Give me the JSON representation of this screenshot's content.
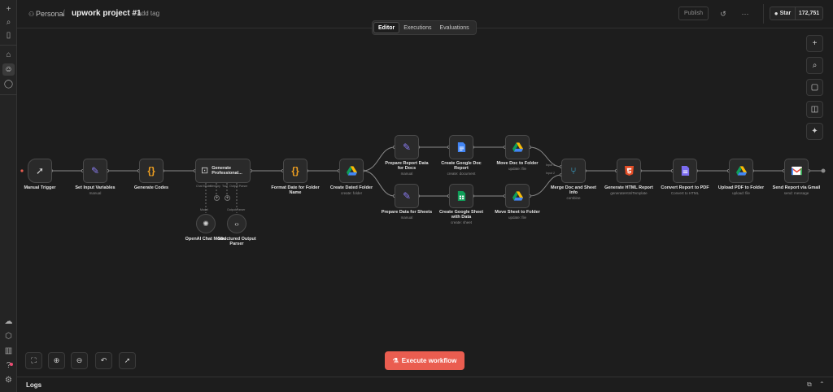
{
  "header": {
    "breadcrumb_project": "Personal",
    "separator": "/",
    "workflow_title": "upwork project #1",
    "add_tag": "+ Add tag",
    "publish": "Publish",
    "github_star": "Star",
    "github_count": "172,751"
  },
  "tabs": [
    "Editor",
    "Executions",
    "Evaluations"
  ],
  "active_tab": "Editor",
  "nodes": {
    "manual_trigger": {
      "label": "Manual Trigger",
      "icon": "cursor-icon"
    },
    "set_input": {
      "label": "Set Input Variables",
      "sub": "manual",
      "icon": "pencil-icon"
    },
    "generate_codes": {
      "label": "Generate Codes",
      "icon": "code-braces-icon"
    },
    "generate_prof": {
      "label": "Generate Professional...",
      "icon": "robot-icon",
      "port_chat": "Chat Model",
      "port_memory": "Memory",
      "port_tool": "Tool",
      "port_output": "Output Parser"
    },
    "openai_chat": {
      "label": "OpenAI Chat Model",
      "icon": "openai-icon"
    },
    "structured_parser": {
      "label": "Structured Output Parser",
      "icon": "code-tag-icon"
    },
    "format_date": {
      "label": "Format Date for Folder Name",
      "icon": "code-braces-icon"
    },
    "create_folder": {
      "label": "Create Dated Folder",
      "sub": "create: folder",
      "icon": "google-drive-icon"
    },
    "prepare_docs": {
      "label": "Prepare Report Data for Docs",
      "sub": "manual",
      "icon": "pencil-icon"
    },
    "create_doc": {
      "label": "Create Google Doc Report",
      "sub": "create: document",
      "icon": "google-docs-icon"
    },
    "move_doc": {
      "label": "Move Doc to Folder",
      "sub": "update: file",
      "icon": "google-drive-icon"
    },
    "prepare_sheets": {
      "label": "Prepare Data for Sheets",
      "sub": "manual",
      "icon": "pencil-icon"
    },
    "create_sheet": {
      "label": "Create Google Sheet with Data",
      "sub": "create: sheet",
      "icon": "google-sheets-icon"
    },
    "move_sheet": {
      "label": "Move Sheet to Folder",
      "sub": "update: file",
      "icon": "google-drive-icon"
    },
    "merge": {
      "label": "Merge Doc and Sheet Info",
      "sub": "combine",
      "icon": "merge-icon",
      "input1": "Input 1",
      "input2": "Input 2"
    },
    "gen_html": {
      "label": "Generate HTML Report",
      "sub": "generateHtmlTemplate",
      "icon": "html5-icon"
    },
    "convert_pdf": {
      "label": "Convert Report to PDF",
      "sub": "Convert to HTML",
      "icon": "pdf-convert-icon"
    },
    "upload_pdf": {
      "label": "Upload PDF to Folder",
      "sub": "upload: file",
      "icon": "google-drive-icon"
    },
    "send_gmail": {
      "label": "Send Report via Gmail",
      "sub": "send: message",
      "icon": "gmail-icon"
    }
  },
  "ai_ports": {
    "model": "Model",
    "output_parser": "Output Parser"
  },
  "execute_button": "Execute workflow",
  "logs_label": "Logs",
  "colors": {
    "accent": "#ea5d50",
    "canvas": "#1d1d1d",
    "node": "#2a2a2a",
    "edge": "#8a8a8a"
  }
}
